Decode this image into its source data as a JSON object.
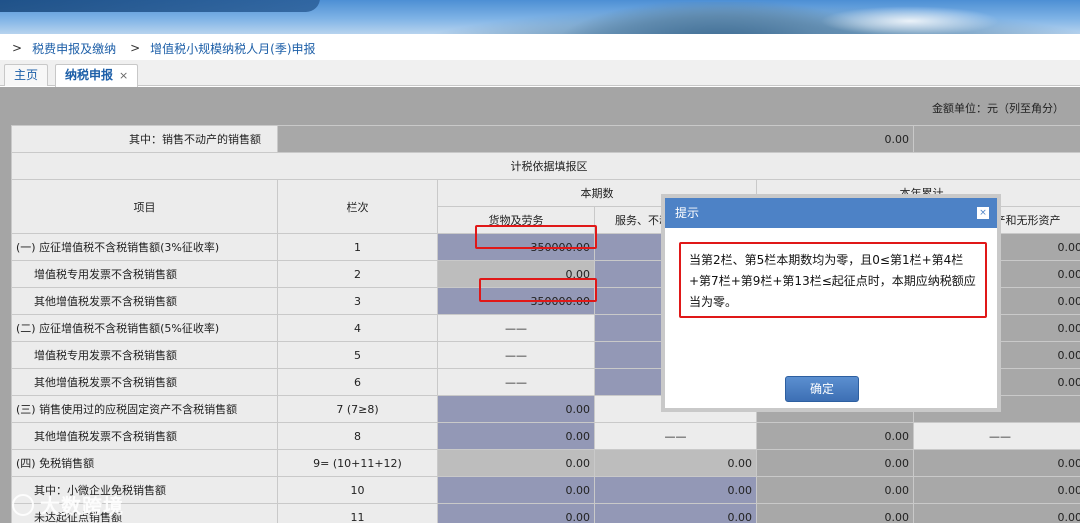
{
  "breadcrumb": [
    "税费申报及缴纳",
    "增值税小规模纳税人月(季)申报"
  ],
  "tabs": [
    {
      "label": "主页",
      "active": false
    },
    {
      "label": "纳税申报",
      "active": true,
      "close": "×"
    }
  ],
  "unit_label": "金额单位：元（列至角分）",
  "top_row": {
    "label": "其中：销售不动产的销售额",
    "value": "0.00"
  },
  "section_title": "计税依据填报区",
  "headers": {
    "item": "项目",
    "column": "栏次",
    "current_period": "本期数",
    "ytd": "本年累计",
    "goods": "货物及劳务",
    "services": "服务、不动产和无形资产",
    "services_ytd": "服务、不动产和无形资产"
  },
  "rows": [
    {
      "label": "(一) 应征增值税不含税销售额(3%征收率)",
      "col": "1",
      "goods": "350000.00",
      "services": "",
      "ytd_goods": "",
      "ytd_services": "0.00"
    },
    {
      "label": "增值税专用发票不含税销售额",
      "col": "2",
      "goods": "0.00",
      "services": "",
      "ytd_goods": "",
      "ytd_services": "0.00"
    },
    {
      "label": "其他增值税发票不含税销售额",
      "col": "3",
      "goods": "350000.00",
      "services": "",
      "ytd_goods": "",
      "ytd_services": "0.00"
    },
    {
      "label": "(二) 应征增值税不含税销售额(5%征收率)",
      "col": "4",
      "goods": "——",
      "services": "",
      "ytd_goods": "",
      "ytd_services": "0.00"
    },
    {
      "label": "增值税专用发票不含税销售额",
      "col": "5",
      "goods": "——",
      "services": "",
      "ytd_goods": "",
      "ytd_services": "0.00"
    },
    {
      "label": "其他增值税发票不含税销售额",
      "col": "6",
      "goods": "——",
      "services": "",
      "ytd_goods": "",
      "ytd_services": "0.00"
    },
    {
      "label": "(三) 销售使用过的应税固定资产不含税销售额",
      "col": "7 (7≥8)",
      "goods": "0.00",
      "services": "",
      "ytd_goods": "",
      "ytd_services": ""
    },
    {
      "label": "其他增值税发票不含税销售额",
      "col": "8",
      "goods": "0.00",
      "services": "——",
      "ytd_goods": "0.00",
      "ytd_services": "——"
    },
    {
      "label": "(四) 免税销售额",
      "col": "9= (10+11+12)",
      "goods": "0.00",
      "services": "0.00",
      "ytd_goods": "0.00",
      "ytd_services": "0.00"
    },
    {
      "label": "其中：小微企业免税销售额",
      "col": "10",
      "goods": "0.00",
      "services": "0.00",
      "ytd_goods": "0.00",
      "ytd_services": "0.00"
    },
    {
      "label": "未达起征点销售额",
      "col": "11",
      "goods": "0.00",
      "services": "0.00",
      "ytd_goods": "0.00",
      "ytd_services": "0.00"
    }
  ],
  "modal": {
    "title": "提示",
    "close": "×",
    "message": "当第2栏、第5栏本期数均为零，且0≤第1栏+第4栏+第7栏+第9栏+第13栏≤起征点时，本期应纳税额应当为零。",
    "ok_label": "确定"
  },
  "watermark": "大数跨境"
}
